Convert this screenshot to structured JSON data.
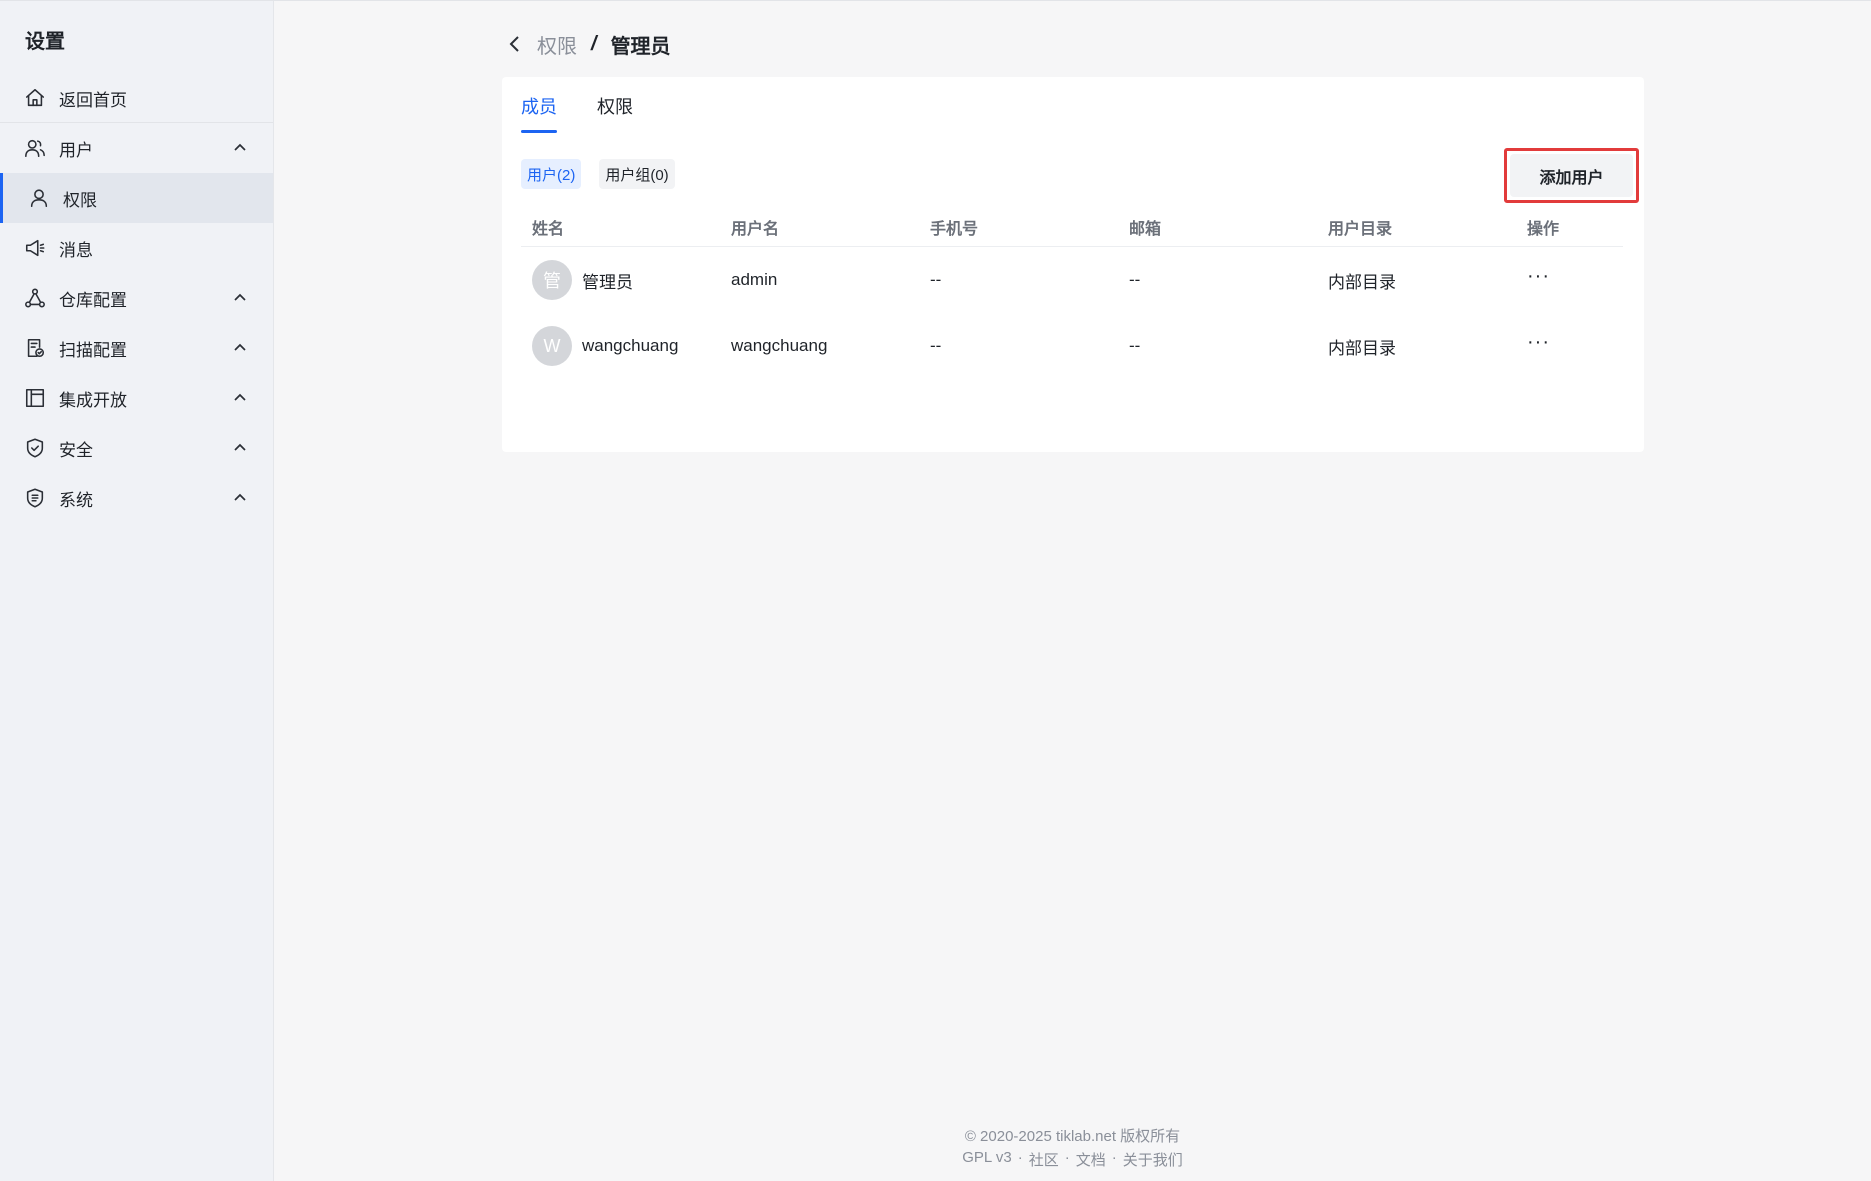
{
  "sidebar": {
    "title": "设置",
    "items": [
      {
        "label": "返回首页",
        "icon": "home-icon"
      },
      {
        "label": "用户",
        "icon": "users-icon"
      },
      {
        "label": "权限",
        "icon": "user-icon"
      },
      {
        "label": "消息",
        "icon": "megaphone-icon"
      },
      {
        "label": "仓库配置",
        "icon": "network-icon"
      },
      {
        "label": "扫描配置",
        "icon": "scan-doc-icon"
      },
      {
        "label": "集成开放",
        "icon": "layout-icon"
      },
      {
        "label": "安全",
        "icon": "shield-check-icon"
      },
      {
        "label": "系统",
        "icon": "shield-cert-icon"
      }
    ]
  },
  "breadcrumb": {
    "parent": "权限",
    "separator": "/",
    "current": "管理员"
  },
  "tabs": [
    {
      "label": "成员"
    },
    {
      "label": "权限"
    }
  ],
  "filters": [
    {
      "label": "用户(2)"
    },
    {
      "label": "用户组(0)"
    }
  ],
  "add_button": "添加用户",
  "table": {
    "headers": [
      "姓名",
      "用户名",
      "手机号",
      "邮箱",
      "用户目录",
      "操作"
    ],
    "rows": [
      {
        "avatar": "管",
        "name": "管理员",
        "username": "admin",
        "phone": "--",
        "email": "--",
        "directory": "内部目录",
        "action": "···"
      },
      {
        "avatar": "W",
        "name": "wangchuang",
        "username": "wangchuang",
        "phone": "--",
        "email": "--",
        "directory": "内部目录",
        "action": "···"
      }
    ]
  },
  "footer": {
    "copyright": "© 2020-2025 tiklab.net 版权所有",
    "license": "GPL v3",
    "dot": "·",
    "community": "社区",
    "docs": "文档",
    "about": "关于我们"
  },
  "colors": {
    "accent": "#1c64f2",
    "highlight_border": "#e23b3b"
  }
}
